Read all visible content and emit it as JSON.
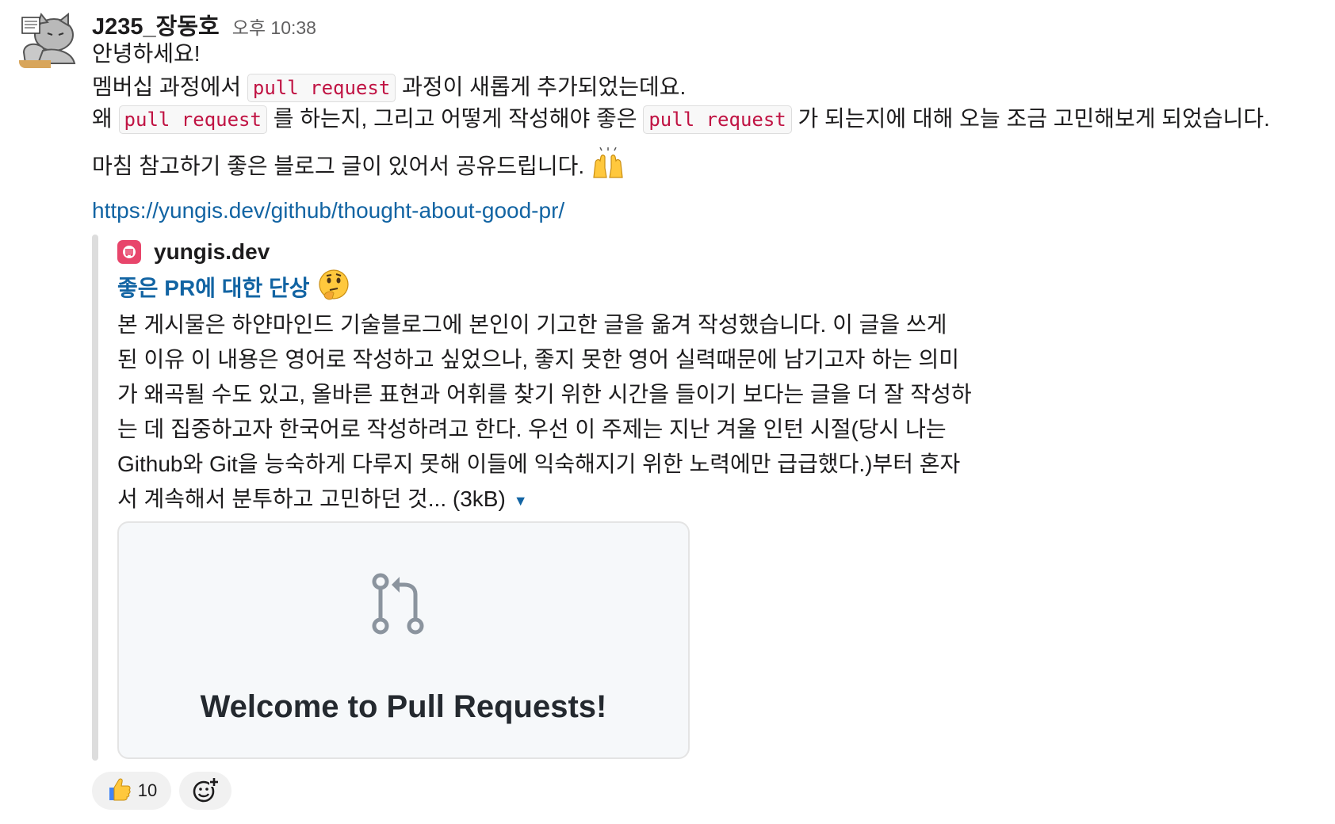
{
  "message": {
    "author": "J235_장동호",
    "time": "오후 10:38",
    "greeting": "안녕하세요!",
    "line2_pre": "멤버십 과정에서",
    "line2_code": "pull request",
    "line2_post": "과정이 새롭게 추가되었는데요.",
    "line3_pre": "왜",
    "line3_code1": "pull request",
    "line3_mid": "를 하는지, 그리고 어떻게 작성해야 좋은",
    "line3_code2": "pull request",
    "line3_post": "가 되는지에 대해 오늘 조금 고민해보게 되었습니다.",
    "line4": "마침 참고하기 좋은 블로그 글이 있어서 공유드립니다.",
    "link": "https://yungis.dev/github/thought-about-good-pr/"
  },
  "unfurl": {
    "site": "yungis.dev",
    "title": "좋은 PR에 대한 단상",
    "description_lines": [
      "본 게시물은 하얀마인드 기술블로그에 본인이 기고한 글을 옮겨 작성했습니다. 이 글을 쓰게",
      "된 이유 이 내용은 영어로 작성하고 싶었으나, 좋지 못한 영어 실력때문에 남기고자 하는 의미",
      "가 왜곡될 수도 있고, 올바른 표현과 어휘를 찾기 위한 시간을 들이기 보다는 글을 더 잘 작성하",
      "는 데 집중하고자 한국어로 작성하려고 한다. 우선 이 주제는 지난 겨울 인턴 시절(당시 나는",
      "Github와 Git을 능숙하게 다루지 못해 이들에 익숙해지기 위한 노력에만 급급했다.)부터 혼자",
      "서 계속해서 분투하고 고민하던 것... (3kB)"
    ],
    "image_title": "Welcome to Pull Requests!"
  },
  "reactions": [
    {
      "emoji": "thumbs-up",
      "count": "10"
    }
  ],
  "colors": {
    "link": "#1264a3",
    "code": "#c01343",
    "site_icon": "#e8456b",
    "text": "#1d1c1d",
    "muted": "#616061"
  },
  "icons": [
    "avatar-cat",
    "raised-hands-emoji",
    "thinking-face-emoji",
    "yungis-site-icon",
    "pull-request-icon",
    "thumbs-up-emoji",
    "add-reaction-icon",
    "expand-caret-icon"
  ]
}
